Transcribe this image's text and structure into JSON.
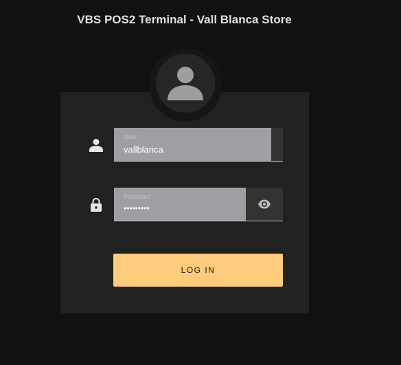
{
  "app": {
    "title": "VBS POS2 Terminal - Vall Blanca Store"
  },
  "avatar": {
    "icon": "account-circle-icon"
  },
  "login_form": {
    "user_field": {
      "icon": "person-icon",
      "label": "User",
      "value": "vallblanca"
    },
    "password_field": {
      "icon": "lock-icon",
      "label": "Password",
      "value": "•••••••••",
      "visibility_toggle_icon": "eye-icon"
    },
    "login_button": {
      "label": "LOG IN"
    }
  },
  "colors": {
    "background": "#111111",
    "card": "#212121",
    "field_fill": "#9e9fa5",
    "accent_button": "#ffcb7c"
  }
}
